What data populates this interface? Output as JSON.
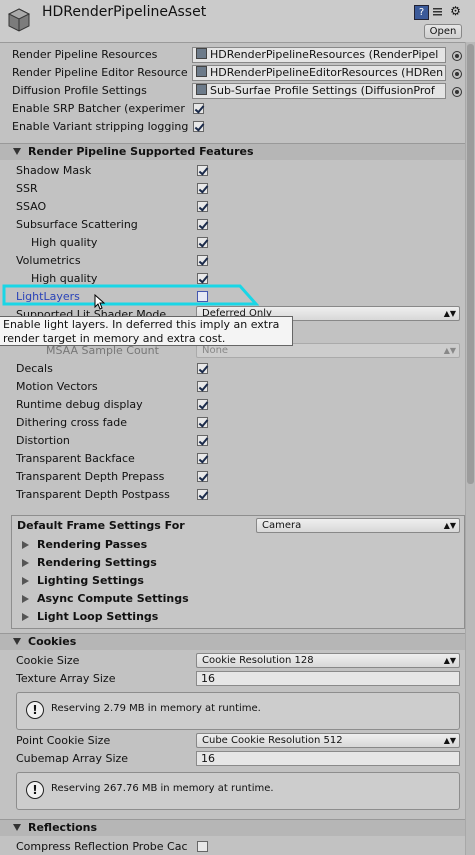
{
  "header": {
    "title": "HDRenderPipelineAsset",
    "open_label": "Open",
    "icons": [
      "help-icon",
      "settings-icon",
      "gear-icon"
    ]
  },
  "resources": [
    {
      "label": "Render Pipeline Resources",
      "value": "HDRenderPipelineResources (RenderPipel"
    },
    {
      "label": "Render Pipeline Editor Resource",
      "value": "HDRenderPipelineEditorResources (HDRen"
    },
    {
      "label": "Diffusion Profile Settings",
      "value": "Sub-Surfae Profile Settings (DiffusionProf"
    }
  ],
  "toggles_top": [
    {
      "label": "Enable SRP Batcher (experimer",
      "checked": true
    },
    {
      "label": "Enable Variant stripping logging",
      "checked": true
    }
  ],
  "features_section": {
    "title": "Render Pipeline Supported Features",
    "items": [
      {
        "label": "Shadow Mask",
        "checked": true
      },
      {
        "label": "SSR",
        "checked": true
      },
      {
        "label": "SSAO",
        "checked": true
      },
      {
        "label": "Subsurface Scattering",
        "checked": true
      },
      {
        "label": "High quality",
        "checked": true,
        "indent": true
      },
      {
        "label": "Volumetrics",
        "checked": true
      },
      {
        "label": "High quality",
        "checked": true,
        "indent": true
      },
      {
        "label": "LightLayers",
        "checked": false,
        "highlight": true
      }
    ],
    "lit_shader_mode_label": "Supported Lit Shader Mode",
    "lit_shader_mode_value": "Deferred Only",
    "msaa_label": "MSAA Sample Count",
    "msaa_value": "None",
    "tooltip": [
      "Enable light layers. In deferred this imply an extra",
      "render target in memory and extra cost."
    ],
    "items2": [
      {
        "label": "Decals",
        "checked": true
      },
      {
        "label": "Motion Vectors",
        "checked": true
      },
      {
        "label": "Runtime debug display",
        "checked": true
      },
      {
        "label": "Dithering cross fade",
        "checked": true
      },
      {
        "label": "Distortion",
        "checked": true
      },
      {
        "label": "Transparent Backface",
        "checked": true
      },
      {
        "label": "Transparent Depth Prepass",
        "checked": true
      },
      {
        "label": "Transparent Depth Postpass",
        "checked": true
      }
    ]
  },
  "frame_settings": {
    "label": "Default Frame Settings For",
    "value": "Camera",
    "foldouts": [
      "Rendering Passes",
      "Rendering Settings",
      "Lighting Settings",
      "Async Compute Settings",
      "Light Loop Settings"
    ]
  },
  "cookies": {
    "title": "Cookies",
    "cookie_size_label": "Cookie Size",
    "cookie_size_value": "Cookie Resolution 128",
    "texture_array_label": "Texture Array Size",
    "texture_array_value": "16",
    "help1": "Reserving 2.79 MB in memory at runtime.",
    "point_cookie_label": "Point Cookie Size",
    "point_cookie_value": "Cube Cookie Resolution 512",
    "cubemap_label": "Cubemap Array Size",
    "cubemap_value": "16",
    "help2": "Reserving 267.76 MB in memory at runtime."
  },
  "reflections": {
    "title": "Reflections",
    "compress_label": "Compress Reflection Probe Cac",
    "compress_checked": false
  },
  "colors": {
    "highlight": "#19d6e6",
    "check": "#1a2a4a"
  }
}
